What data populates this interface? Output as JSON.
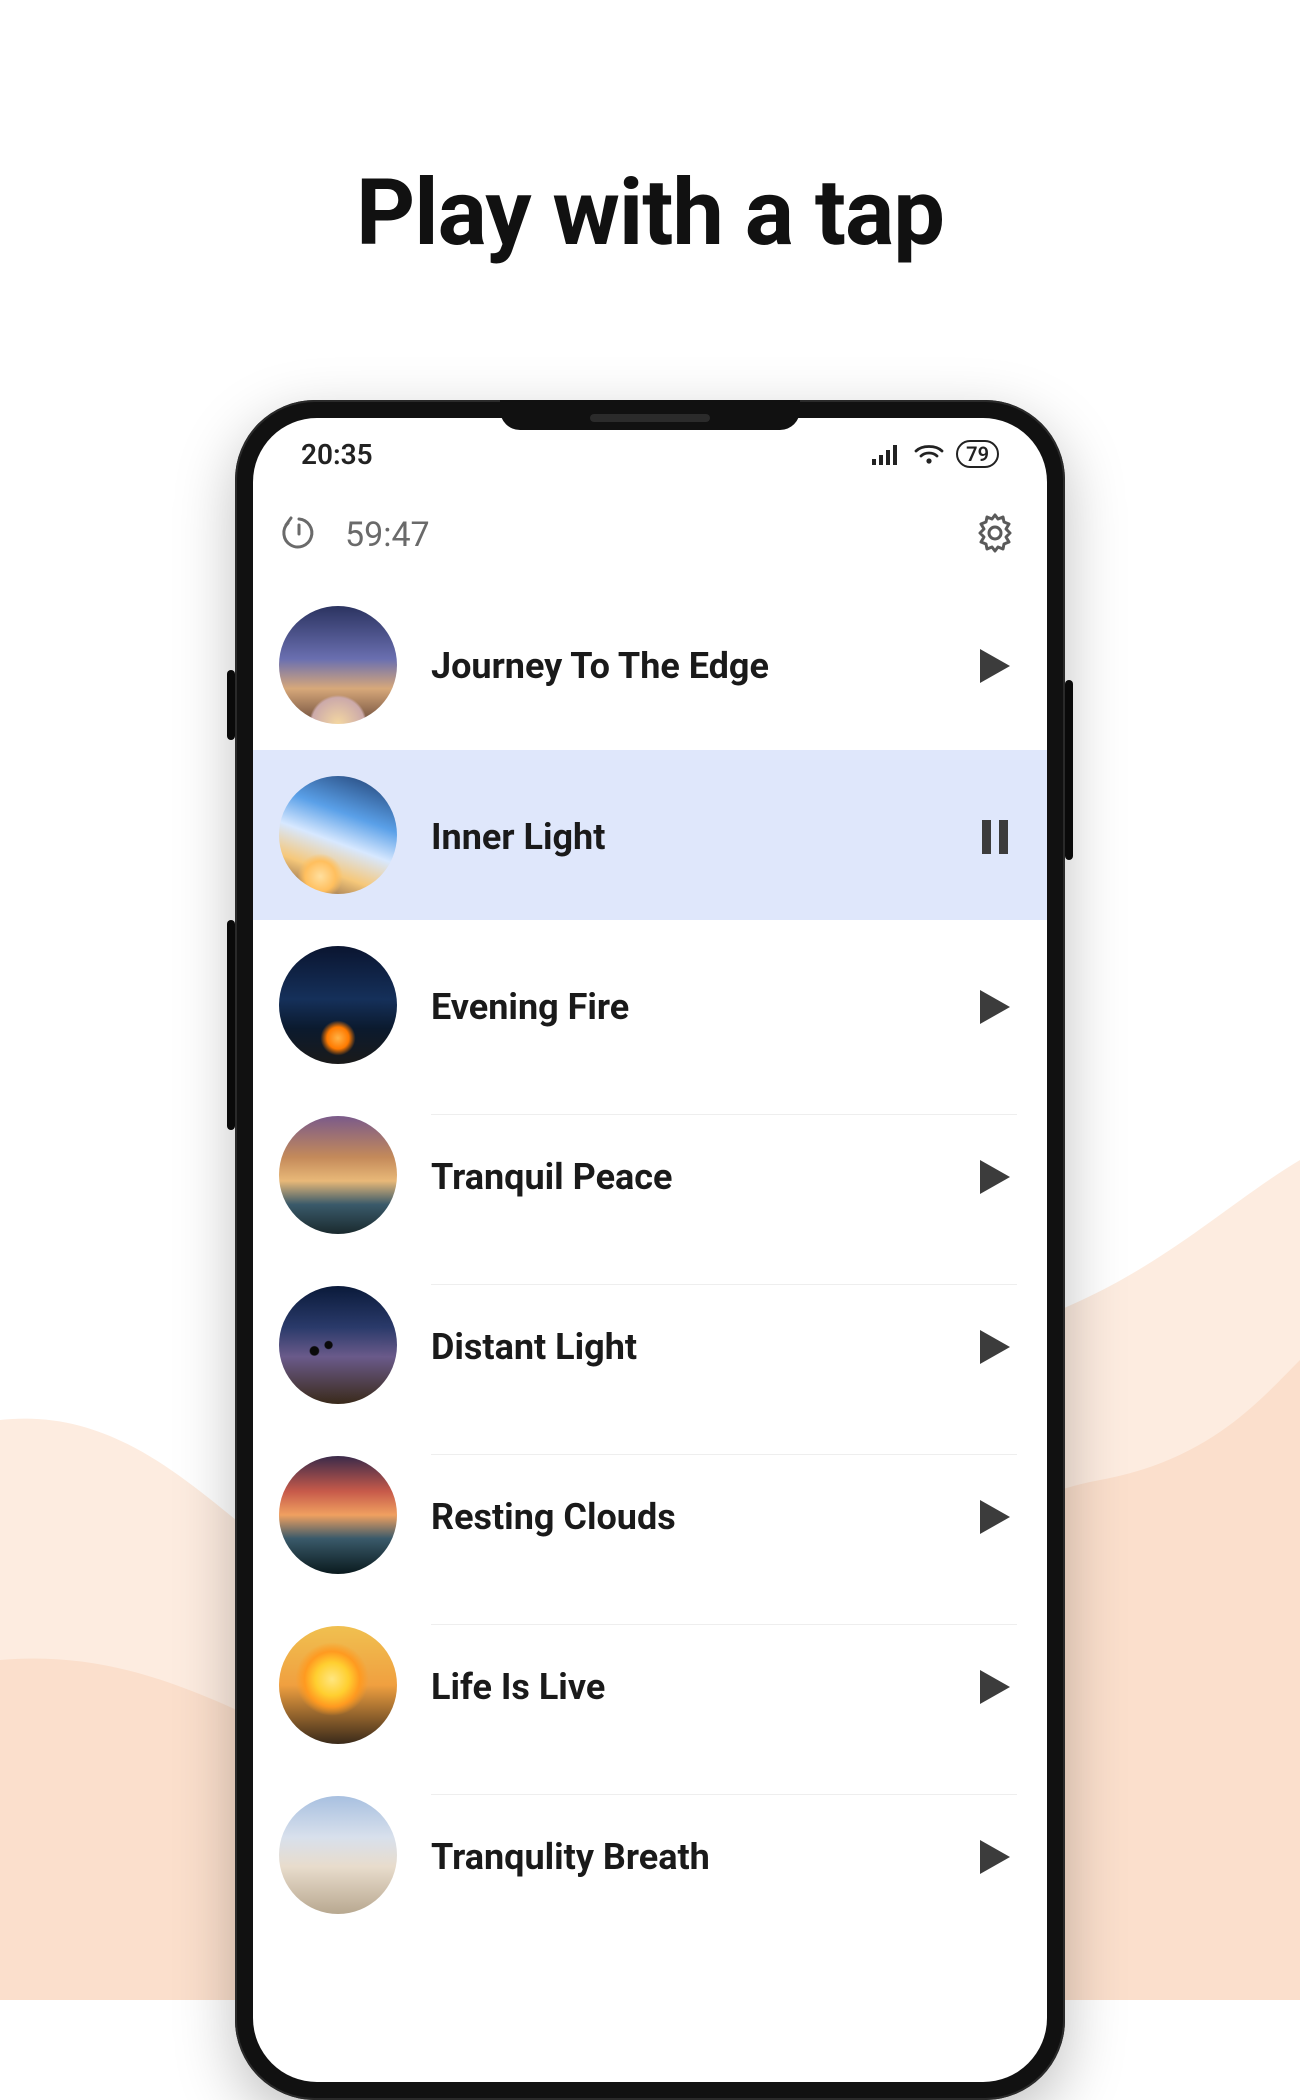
{
  "headline": "Play with a tap",
  "status": {
    "time": "20:35",
    "battery": "79"
  },
  "header": {
    "timer": "59:47"
  },
  "tracks": [
    {
      "title": "Journey To The Edge",
      "playing": false
    },
    {
      "title": "Inner Light",
      "playing": true
    },
    {
      "title": "Evening Fire",
      "playing": false
    },
    {
      "title": "Tranquil Peace",
      "playing": false
    },
    {
      "title": "Distant Light",
      "playing": false
    },
    {
      "title": "Resting Clouds",
      "playing": false
    },
    {
      "title": "Life Is Live",
      "playing": false
    },
    {
      "title": "Tranqulity Breath",
      "playing": false
    }
  ]
}
